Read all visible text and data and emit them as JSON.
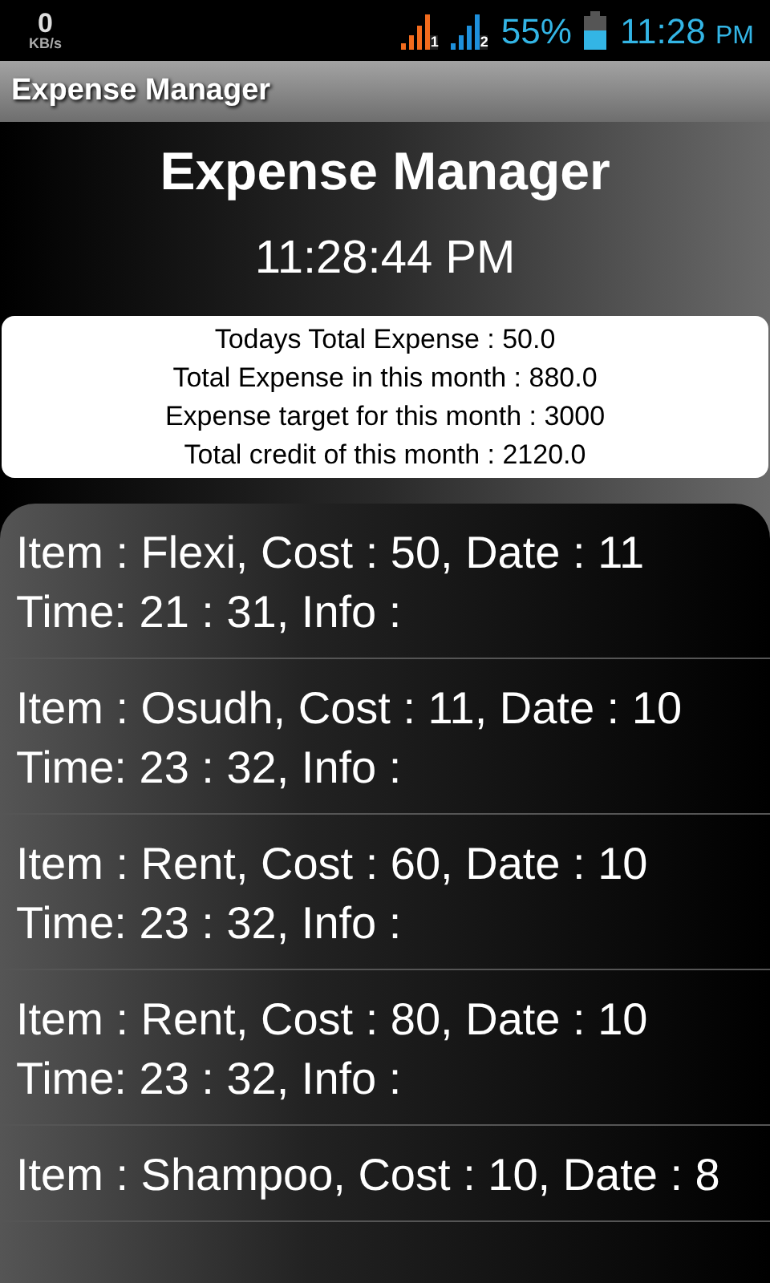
{
  "status_bar": {
    "speed": "0",
    "speed_unit": "KB/s",
    "sim_1": "1",
    "sim_2": "2",
    "battery": "55%",
    "time": "11:28",
    "ampm": "PM"
  },
  "action_bar": {
    "title": "Expense Manager"
  },
  "header": {
    "title": "Expense Manager",
    "clock": "11:28:44 PM"
  },
  "summary": [
    "Todays Total Expense : 50.0",
    "Total Expense in this month : 880.0",
    "Expense target for this month : 3000",
    "Total credit of this month : 2120.0"
  ],
  "expenses": [
    {
      "line_1": "Item : Flexi, Cost : 50, Date : 11",
      "line_2": "Time: 21 : 31, Info :"
    },
    {
      "line_1": "Item : Osudh, Cost : 11, Date : 10",
      "line_2": "Time: 23 : 32, Info :"
    },
    {
      "line_1": "Item : Rent, Cost : 60, Date : 10",
      "line_2": "Time: 23 : 32, Info :"
    },
    {
      "line_1": "Item : Rent, Cost : 80, Date : 10",
      "line_2": "Time: 23 : 32, Info :"
    },
    {
      "line_1": "Item : Shampoo, Cost : 10, Date : 8"
    }
  ]
}
